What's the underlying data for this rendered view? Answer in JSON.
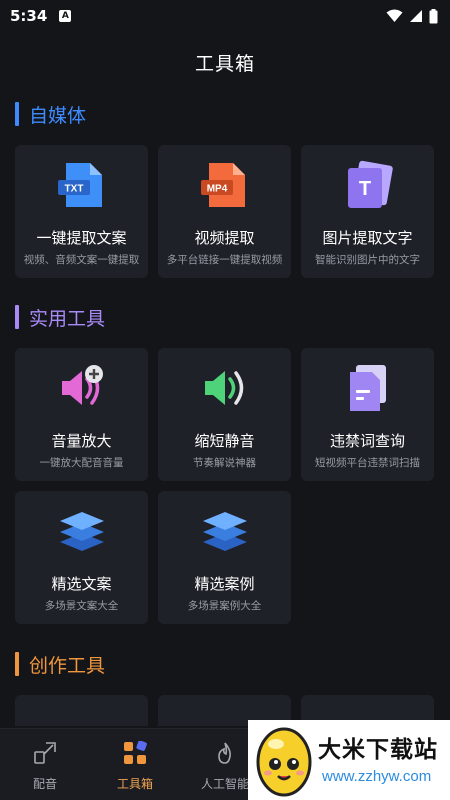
{
  "status_bar": {
    "time": "5:34",
    "notification_badge": "A",
    "icons": [
      "wifi-icon",
      "signal-icon",
      "battery-icon"
    ]
  },
  "app_bar": {
    "title": "工具箱"
  },
  "sections": [
    {
      "title": "自媒体",
      "accent": "#3d8bff",
      "items": [
        {
          "name": "一键提取文案",
          "desc": "视频、音频文案一键提取",
          "icon": "txt-file-icon",
          "icon_text": "TXT"
        },
        {
          "name": "视频提取",
          "desc": "多平台链接一键提取视频",
          "icon": "mp4-file-icon",
          "icon_text": "MP4"
        },
        {
          "name": "图片提取文字",
          "desc": "智能识别图片中的文字",
          "icon": "image-text-icon",
          "icon_text": "T"
        }
      ]
    },
    {
      "title": "实用工具",
      "accent": "#a98bf7",
      "items": [
        {
          "name": "音量放大",
          "desc": "一键放大配音音量",
          "icon": "volume-up-icon"
        },
        {
          "name": "缩短静音",
          "desc": "节奏解说神器",
          "icon": "volume-icon"
        },
        {
          "name": "违禁词查询",
          "desc": "短视频平台违禁词扫描",
          "icon": "document-check-icon"
        },
        {
          "name": "精选文案",
          "desc": "多场景文案大全",
          "icon": "layers-icon"
        },
        {
          "name": "精选案例",
          "desc": "多场景案例大全",
          "icon": "layers-icon"
        }
      ]
    },
    {
      "title": "创作工具",
      "accent": "#f0963c",
      "items": []
    }
  ],
  "tabs": [
    {
      "label": "配音",
      "icon": "dubbing-icon",
      "active": false
    },
    {
      "label": "工具箱",
      "icon": "toolbox-icon",
      "active": true
    },
    {
      "label": "人工智能",
      "icon": "flame-icon",
      "active": false
    }
  ],
  "ad": {
    "brand": "大米下载站",
    "url": "www.zzhyw.com"
  },
  "colors": {
    "background": "#141519",
    "card": "#1f2129",
    "active_tab": "#f0a451"
  }
}
